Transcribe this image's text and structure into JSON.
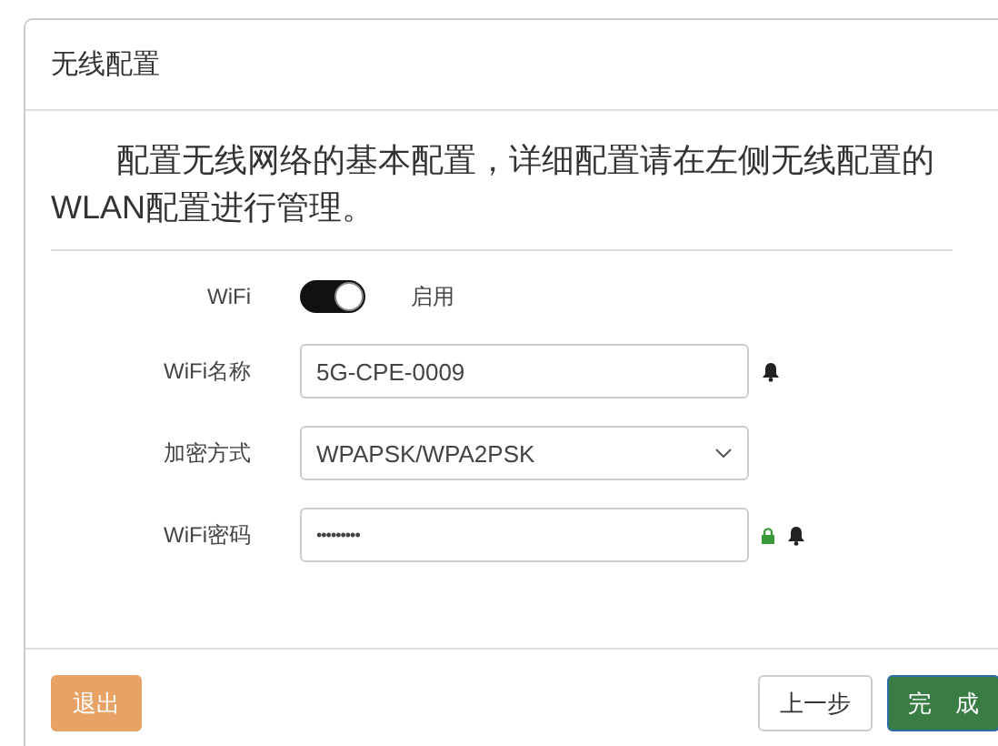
{
  "dialog": {
    "title": "无线配置"
  },
  "intro": "配置无线网络的基本配置，详细配置请在左侧无线配置的WLAN配置进行管理。",
  "form": [
    {
      "kind": "switch",
      "label": "WiFi",
      "on": true,
      "status": "启用"
    },
    {
      "kind": "text",
      "label": "WiFi名称",
      "value": "5G-CPE-0009",
      "bell": true
    },
    {
      "kind": "select",
      "label": "加密方式",
      "value": "WPAPSK/WPA2PSK"
    },
    {
      "kind": "password",
      "label": "WiFi密码",
      "value": "•••••••••",
      "lock": true,
      "bell": true
    }
  ],
  "buttons": [
    {
      "kind": "warning",
      "label": "退出"
    },
    {
      "kind": "default",
      "label": "上一步"
    },
    {
      "kind": "success",
      "label": "完　成"
    }
  ]
}
